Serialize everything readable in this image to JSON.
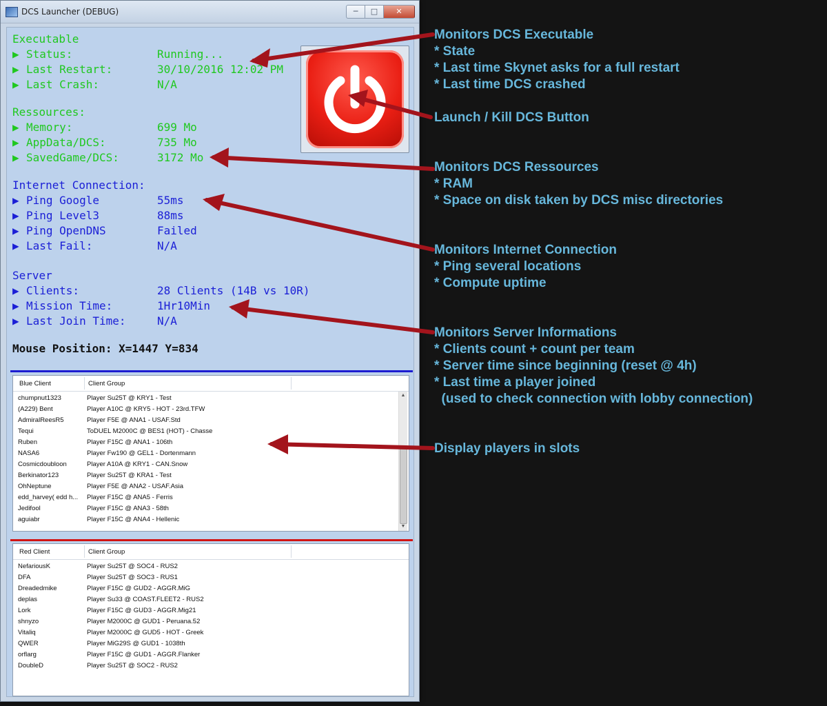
{
  "window": {
    "title": "DCS Launcher (DEBUG)",
    "caption_buttons": [
      "─",
      "□",
      "✕"
    ]
  },
  "status": {
    "executable": {
      "title": "Executable",
      "rows": [
        {
          "label": "Status:",
          "value": "Running..."
        },
        {
          "label": "Last Restart:",
          "value": "30/10/2016 12:02 PM"
        },
        {
          "label": "Last Crash:",
          "value": "N/A"
        }
      ]
    },
    "resources": {
      "title": "Ressources:",
      "rows": [
        {
          "label": "Memory:",
          "value": "699 Mo"
        },
        {
          "label": "AppData/DCS:",
          "value": "735 Mo"
        },
        {
          "label": "SavedGame/DCS:",
          "value": "3172 Mo"
        }
      ]
    },
    "internet": {
      "title": "Internet Connection:",
      "rows": [
        {
          "label": "Ping Google",
          "value": "55ms"
        },
        {
          "label": "Ping Level3",
          "value": "88ms"
        },
        {
          "label": "Ping OpenDNS",
          "value": "Failed"
        },
        {
          "label": "Last Fail:",
          "value": "N/A"
        }
      ]
    },
    "server": {
      "title": "Server",
      "rows": [
        {
          "label": "Clients:",
          "value": "28 Clients (14B vs 10R)"
        },
        {
          "label": "Mission Time:",
          "value": "1Hr10Min"
        },
        {
          "label": "Last Join Time:",
          "value": "N/A"
        }
      ]
    },
    "mouse_position": "Mouse Position: X=1447 Y=834",
    "bullet_icon": "triangle-right-icon",
    "power_icon": "power-icon"
  },
  "blue_list": {
    "headers": [
      "Blue Client",
      "Client Group"
    ],
    "rows": [
      [
        "chumpnut1323",
        "Player Su25T @ KRY1 - Test"
      ],
      [
        "(A229) Bent",
        "Player A10C @ KRY5 - HOT - 23rd.TFW"
      ],
      [
        "AdmiralReesR5",
        "Player F5E @ ANA1 - USAF.Std"
      ],
      [
        "Tequi",
        "ToDUEL M2000C @ BES1 (HOT) - Chasse"
      ],
      [
        "Ruben",
        "Player F15C @ ANA1 - 106th"
      ],
      [
        "NASA6",
        "Player Fw190 @ GEL1 - Dortenmann"
      ],
      [
        "Cosmicdoubloon",
        "Player A10A @ KRY1 - CAN.Snow"
      ],
      [
        "Berkinator123",
        "Player Su25T @ KRA1 - Test"
      ],
      [
        "OhNeptune",
        "Player F5E @ ANA2 - USAF.Asia"
      ],
      [
        "edd_harvey( edd h...",
        "Player F15C @ ANA5 - Ferris"
      ],
      [
        "Jedifool",
        "Player F15C @ ANA3 - 58th"
      ],
      [
        "aguiabr",
        "Player F15C @ ANA4 - Hellenic"
      ]
    ]
  },
  "red_list": {
    "headers": [
      "Red Client",
      "Client Group"
    ],
    "rows": [
      [
        "NefariousK",
        "Player Su25T @ SOC4 - RUS2"
      ],
      [
        "DFA",
        "Player Su25T @ SOC3 - RUS1"
      ],
      [
        "Dreadedmike",
        "Player F15C @ GUD2 - AGGR.MiG"
      ],
      [
        "deplas",
        "Player Su33 @ COAST.FLEET2 - RUS2"
      ],
      [
        "Lork",
        "Player F15C @ GUD3 - AGGR.Mig21"
      ],
      [
        "shnyzo",
        "Player M2000C @ GUD1 - Peruana.52"
      ],
      [
        "Vitaliq",
        "Player M2000C @ GUD5 - HOT - Greek"
      ],
      [
        "QWER",
        "Player MiG29S @ GUD1 - 1038th"
      ],
      [
        "orflarg",
        "Player F15C @ GUD1 - AGGR.Flanker"
      ],
      [
        "DoubleD",
        "Player Su25T @ SOC2 - RUS2"
      ]
    ]
  },
  "annotations": {
    "executable": "Monitors DCS Executable\n* State\n* Last time Skynet asks for a full restart\n* Last time DCS crashed",
    "button": "Launch / Kill DCS Button",
    "resources": "Monitors DCS Ressources\n* RAM\n* Space on disk taken by DCS misc directories",
    "internet": "Monitors Internet Connection\n* Ping several locations\n* Compute uptime",
    "server": "Monitors Server Informations\n* Clients count + count per team\n* Server time since beginning (reset @ 4h)\n* Last time a player joined\n  (used to check connection with lobby connection)",
    "players": "Display players in slots"
  },
  "colors": {
    "green_text": "#20c820",
    "blue_text": "#1b1fd6",
    "annotation_text": "#67b7db",
    "arrow": "#a3141c",
    "blue_divider": "#1c1cd0",
    "red_divider": "#d21414"
  }
}
